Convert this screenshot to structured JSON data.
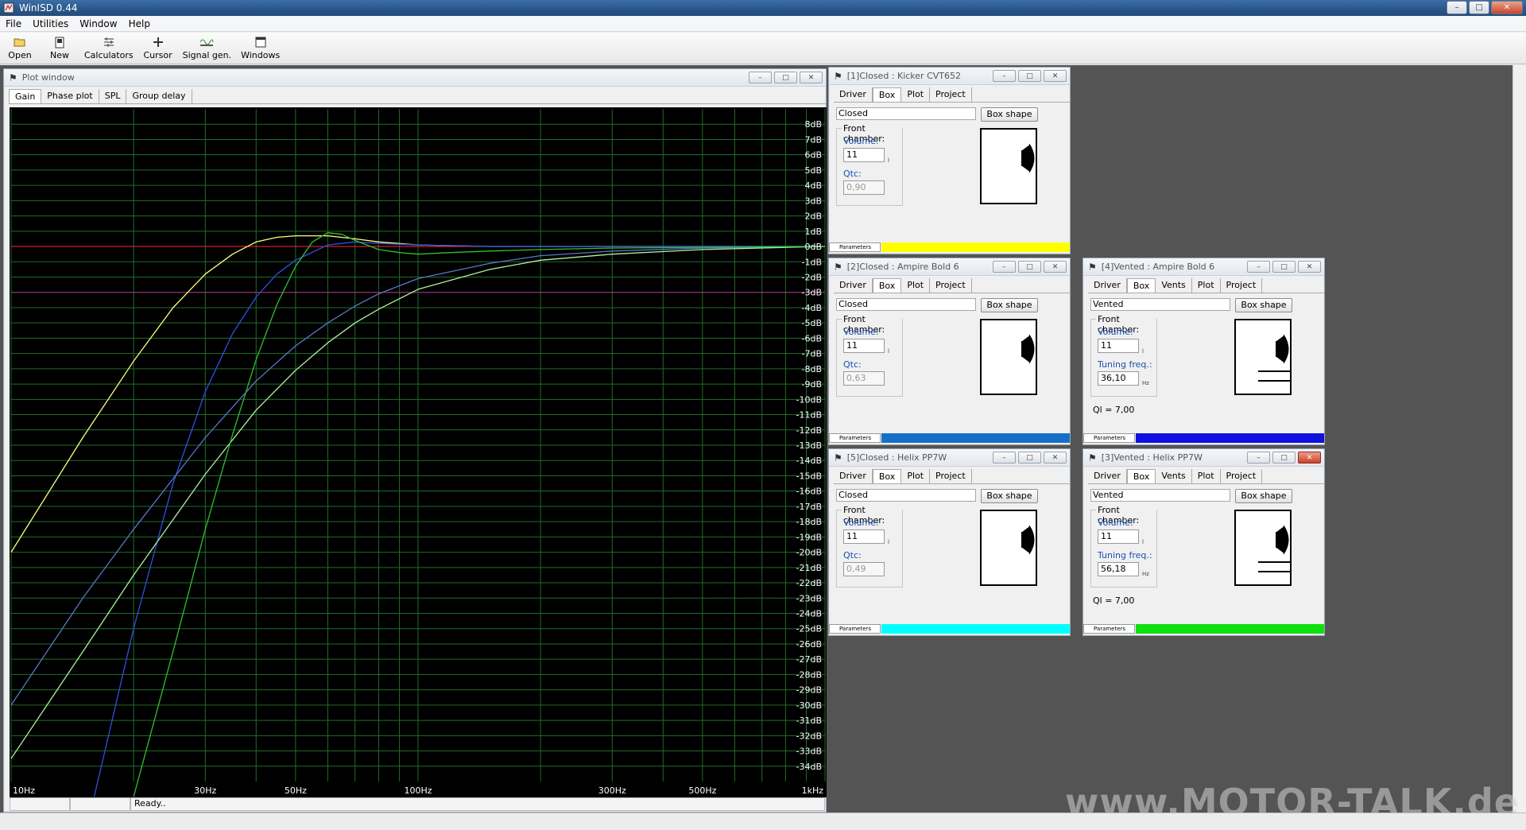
{
  "app": {
    "title": "WinISD 0.44"
  },
  "menu": [
    "File",
    "Utilities",
    "Window",
    "Help"
  ],
  "toolbar": [
    {
      "label": "Open",
      "icon": "open-icon"
    },
    {
      "label": "New",
      "icon": "new-icon"
    },
    {
      "label": "Calculators",
      "icon": "calculators-icon"
    },
    {
      "label": "Cursor",
      "icon": "cursor-icon"
    },
    {
      "label": "Signal gen.",
      "icon": "signal-gen-icon"
    },
    {
      "label": "Windows",
      "icon": "windows-icon"
    }
  ],
  "plot_window": {
    "title": "Plot window",
    "tabs": [
      "Gain",
      "Phase plot",
      "SPL",
      "Group delay"
    ],
    "active_tab": "Gain",
    "status": "Ready.."
  },
  "chart_data": {
    "type": "line",
    "x_scale": "log",
    "xlim": [
      10,
      1000
    ],
    "ylim": [
      -35,
      9
    ],
    "x_tick_labels": [
      {
        "value": 10,
        "label": "10Hz"
      },
      {
        "value": 30,
        "label": "30Hz"
      },
      {
        "value": 50,
        "label": "50Hz"
      },
      {
        "value": 100,
        "label": "100Hz"
      },
      {
        "value": 300,
        "label": "300Hz"
      },
      {
        "value": 500,
        "label": "500Hz"
      },
      {
        "value": 1000,
        "label": "1kHz"
      }
    ],
    "y_tick_labels": [
      "8dB",
      "7dB",
      "6dB",
      "5dB",
      "4dB",
      "3dB",
      "2dB",
      "1dB",
      "0dB",
      "-1dB",
      "-2dB",
      "-3dB",
      "-4dB",
      "-5dB",
      "-6dB",
      "-7dB",
      "-8dB",
      "-9dB",
      "-10dB",
      "-11dB",
      "-12dB",
      "-13dB",
      "-14dB",
      "-15dB",
      "-16dB",
      "-17dB",
      "-18dB",
      "-19dB",
      "-20dB",
      "-21dB",
      "-22dB",
      "-23dB",
      "-24dB",
      "-25dB",
      "-26dB",
      "-27dB",
      "-28dB",
      "-29dB",
      "-30dB",
      "-31dB",
      "-32dB",
      "-33dB",
      "-34dB"
    ],
    "y_tick_values": [
      8,
      7,
      6,
      5,
      4,
      3,
      2,
      1,
      0,
      -1,
      -2,
      -3,
      -4,
      -5,
      -6,
      -7,
      -8,
      -9,
      -10,
      -11,
      -12,
      -13,
      -14,
      -15,
      -16,
      -17,
      -18,
      -19,
      -20,
      -21,
      -22,
      -23,
      -24,
      -25,
      -26,
      -27,
      -28,
      -29,
      -30,
      -31,
      -32,
      -33,
      -34
    ],
    "grid": true,
    "reference_lines": [
      {
        "y": 0,
        "color": "#ff2040"
      },
      {
        "y": -3,
        "color": "#b0208a"
      }
    ],
    "series": [
      {
        "color": "#ffff80",
        "x": [
          10,
          15,
          20,
          25,
          30,
          35,
          40,
          45,
          50,
          60,
          70,
          80,
          100,
          150,
          200,
          300,
          500,
          1000
        ],
        "y": [
          -20,
          -12.5,
          -7.5,
          -4,
          -1.8,
          -0.5,
          0.3,
          0.6,
          0.7,
          0.7,
          0.5,
          0.3,
          0.1,
          0,
          0,
          0,
          0,
          0
        ]
      },
      {
        "color": "#3050e0",
        "x": [
          16,
          20,
          25,
          30,
          35,
          40,
          45,
          50,
          60,
          70,
          80,
          100,
          150,
          200,
          300,
          500,
          1000
        ],
        "y": [
          -36,
          -25,
          -15.5,
          -9.5,
          -5.7,
          -3.3,
          -1.8,
          -0.9,
          0.1,
          0.3,
          0.2,
          0.1,
          0,
          0,
          0,
          0,
          0
        ]
      },
      {
        "color": "#5878c8",
        "x": [
          10,
          15,
          20,
          30,
          40,
          50,
          60,
          70,
          80,
          100,
          150,
          200,
          300,
          500,
          1000
        ],
        "y": [
          -30,
          -23,
          -18.5,
          -12.5,
          -8.8,
          -6.5,
          -5,
          -3.9,
          -3.1,
          -2.1,
          -1.1,
          -0.6,
          -0.3,
          -0.1,
          0
        ]
      },
      {
        "color": "#b0f0a0",
        "x": [
          10,
          15,
          20,
          30,
          40,
          50,
          60,
          70,
          80,
          100,
          150,
          200,
          300,
          500,
          1000
        ],
        "y": [
          -33.5,
          -26.5,
          -21.5,
          -14.9,
          -10.7,
          -8.1,
          -6.3,
          -5,
          -4.1,
          -2.8,
          -1.5,
          -0.9,
          -0.5,
          -0.2,
          0
        ]
      },
      {
        "color": "#30c030",
        "x": [
          20,
          25,
          30,
          35,
          40,
          45,
          50,
          55,
          60,
          65,
          70,
          80,
          90,
          100,
          120,
          150,
          200,
          300,
          1000
        ],
        "y": [
          -36,
          -26.5,
          -18.5,
          -12.3,
          -7.4,
          -3.8,
          -1.3,
          0.3,
          0.9,
          0.8,
          0.4,
          -0.2,
          -0.4,
          -0.5,
          -0.4,
          -0.3,
          -0.2,
          -0.1,
          0
        ]
      }
    ]
  },
  "panels": [
    {
      "title": "[1]Closed : Kicker CVT652",
      "tabs": [
        "Driver",
        "Box",
        "Plot",
        "Project"
      ],
      "box_type": "Closed",
      "box_shape_label": "Box shape",
      "front_chamber_label": "Front chamber:",
      "volume_label": "Volume:",
      "volume": "11",
      "volume_unit": "l",
      "param2_label": "Qtc:",
      "param2_value": "0,90",
      "footer_label": "Parameters",
      "color": "#ffff00"
    },
    {
      "title": "[2]Closed : Ampire Bold 6",
      "tabs": [
        "Driver",
        "Box",
        "Plot",
        "Project"
      ],
      "box_type": "Closed",
      "box_shape_label": "Box shape",
      "front_chamber_label": "Front chamber:",
      "volume_label": "Volume:",
      "volume": "11",
      "volume_unit": "l",
      "param2_label": "Qtc:",
      "param2_value": "0,63",
      "footer_label": "Parameters",
      "color": "#1670c8"
    },
    {
      "title": "[5]Closed : Helix PP7W",
      "tabs": [
        "Driver",
        "Box",
        "Plot",
        "Project"
      ],
      "box_type": "Closed",
      "box_shape_label": "Box shape",
      "front_chamber_label": "Front chamber:",
      "volume_label": "Volume:",
      "volume": "11",
      "volume_unit": "l",
      "param2_label": "Qtc:",
      "param2_value": "0,49",
      "footer_label": "Parameters",
      "color": "#00ffff"
    },
    {
      "title": "[4]Vented : Ampire Bold 6",
      "tabs": [
        "Driver",
        "Box",
        "Vents",
        "Plot",
        "Project"
      ],
      "box_type": "Vented",
      "box_shape_label": "Box shape",
      "front_chamber_label": "Front chamber:",
      "volume_label": "Volume:",
      "volume": "11",
      "volume_unit": "l",
      "param2_label": "Tuning freq.:",
      "param2_value": "36,10",
      "param2_unit": "Hz",
      "ql": "Ql = 7,00",
      "footer_label": "Parameters",
      "color": "#1010e0"
    },
    {
      "title": "[3]Vented : Helix PP7W",
      "tabs": [
        "Driver",
        "Box",
        "Vents",
        "Plot",
        "Project"
      ],
      "box_type": "Vented",
      "box_shape_label": "Box shape",
      "front_chamber_label": "Front chamber:",
      "volume_label": "Volume:",
      "volume": "11",
      "volume_unit": "l",
      "param2_label": "Tuning freq.:",
      "param2_value": "56,18",
      "param2_unit": "Hz",
      "ql": "Ql = 7,00",
      "footer_label": "Parameters",
      "color": "#10e010"
    }
  ],
  "watermark": "www.MOTOR-TALK.de"
}
